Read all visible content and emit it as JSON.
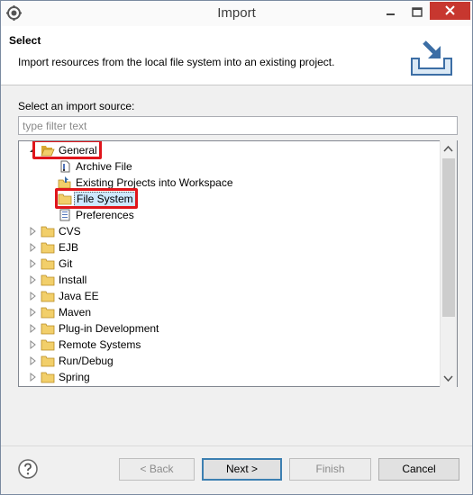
{
  "window": {
    "title": "Import"
  },
  "header": {
    "title": "Select",
    "description": "Import resources from the local file system into an existing project."
  },
  "source": {
    "label": "Select an import source:",
    "filter_placeholder": "type filter text"
  },
  "tree": {
    "general": {
      "label": "General",
      "children": [
        "Archive File",
        "Existing Projects into Workspace",
        "File System",
        "Preferences"
      ],
      "selected": "File System"
    },
    "folders": [
      "CVS",
      "EJB",
      "Git",
      "Install",
      "Java EE",
      "Maven",
      "Plug-in Development",
      "Remote Systems",
      "Run/Debug",
      "Spring"
    ]
  },
  "buttons": {
    "back": "< Back",
    "next": "Next >",
    "finish": "Finish",
    "cancel": "Cancel"
  },
  "colors": {
    "close": "#c7372f",
    "highlight": "#e0151b",
    "selection": "#cde8ff",
    "folder": "#e8c05a"
  }
}
